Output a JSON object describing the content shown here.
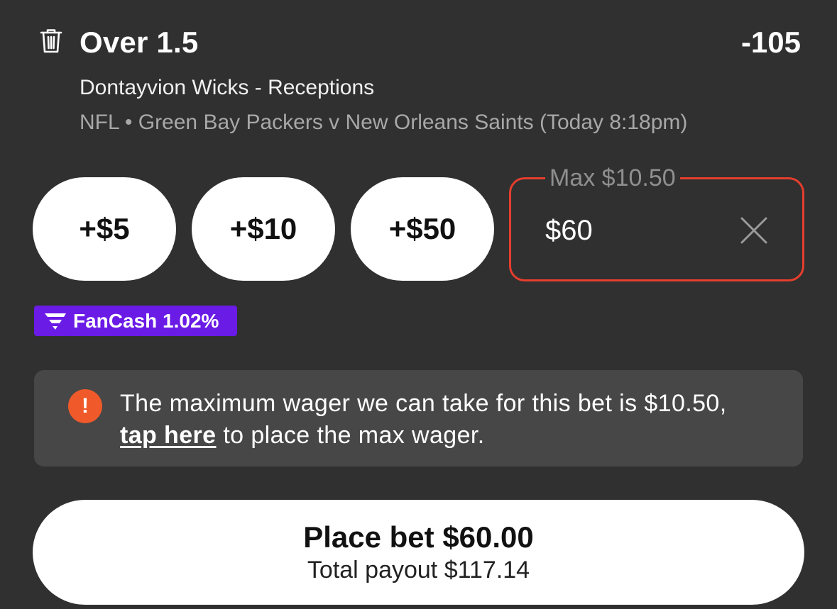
{
  "bet": {
    "selection": "Over 1.5",
    "odds": "-105",
    "market": "Dontayvion Wicks - Receptions",
    "event": "NFL • Green Bay Packers v New Orleans Saints (Today 8:18pm)"
  },
  "quick_stakes": [
    "+$5",
    "+$10",
    "+$50"
  ],
  "wager": {
    "max_label": "Max $10.50",
    "value": "$60"
  },
  "fancash": {
    "label": "FanCash 1.02%"
  },
  "notice": {
    "text_before": "The maximum wager we can take for this bet is $10.50,",
    "link": "tap here",
    "text_after": "to place the max wager.",
    "icon": "!"
  },
  "place_bet": {
    "label": "Place bet $60.00",
    "payout": "Total payout $117.14"
  },
  "colors": {
    "background": "#303030",
    "error_border": "#e53e2e",
    "fancash_purple": "#6a1be6",
    "alert_orange": "#f05a2a",
    "notice_background": "#474747"
  }
}
